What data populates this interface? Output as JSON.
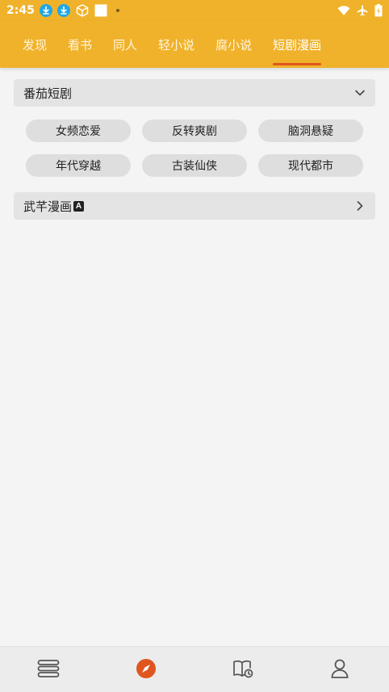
{
  "status_bar": {
    "time": "2:45",
    "icons_left": [
      "download-icon",
      "download-icon",
      "cube-icon",
      "square-icon",
      "dot-icon"
    ],
    "icons_right": [
      "wifi-icon",
      "airplane-icon",
      "battery-charging-icon"
    ]
  },
  "tabs": [
    {
      "label": "发现",
      "active": false
    },
    {
      "label": "看书",
      "active": false
    },
    {
      "label": "同人",
      "active": false
    },
    {
      "label": "轻小说",
      "active": false
    },
    {
      "label": "腐小说",
      "active": false
    },
    {
      "label": "短剧漫画",
      "active": true
    }
  ],
  "groups": [
    {
      "title": "番茄短剧",
      "expanded": true,
      "chips": [
        "女频恋爱",
        "反转爽剧",
        "脑洞悬疑",
        "年代穿越",
        "古装仙侠",
        "现代都市"
      ]
    },
    {
      "title": "武芊漫画",
      "badge": "A",
      "expanded": false
    }
  ],
  "bottom_nav": [
    {
      "icon": "bookshelf-icon",
      "active": false
    },
    {
      "icon": "discover-compass-icon",
      "active": true
    },
    {
      "icon": "reading-history-icon",
      "active": false
    },
    {
      "icon": "profile-icon",
      "active": false
    }
  ],
  "colors": {
    "accent": "#f0b22a",
    "tab_indicator": "#e0561f",
    "active_nav": "#e0561f",
    "background": "#f4f4f4"
  }
}
